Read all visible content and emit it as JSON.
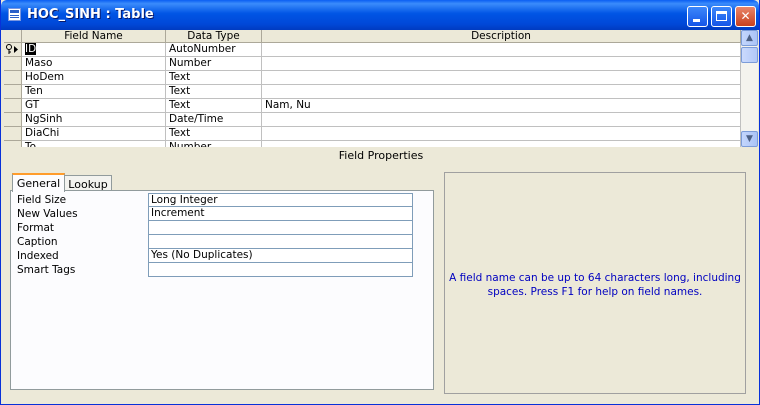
{
  "window": {
    "title": "HOC_SINH : Table"
  },
  "grid": {
    "columns": [
      "Field Name",
      "Data Type",
      "Description"
    ],
    "rows": [
      {
        "name": "ID",
        "type": "AutoNumber",
        "desc": ""
      },
      {
        "name": "Maso",
        "type": "Number",
        "desc": ""
      },
      {
        "name": "HoDem",
        "type": "Text",
        "desc": ""
      },
      {
        "name": "Ten",
        "type": "Text",
        "desc": ""
      },
      {
        "name": "GT",
        "type": "Text",
        "desc": "Nam, Nu"
      },
      {
        "name": "NgSinh",
        "type": "Date/Time",
        "desc": ""
      },
      {
        "name": "DiaChi",
        "type": "Text",
        "desc": ""
      },
      {
        "name": "To",
        "type": "Number",
        "desc": ""
      }
    ]
  },
  "field_properties": {
    "header": "Field Properties",
    "tabs": [
      "General",
      "Lookup"
    ],
    "properties": [
      {
        "label": "Field Size",
        "value": "Long Integer"
      },
      {
        "label": "New Values",
        "value": "Increment"
      },
      {
        "label": "Format",
        "value": ""
      },
      {
        "label": "Caption",
        "value": ""
      },
      {
        "label": "Indexed",
        "value": "Yes (No Duplicates)"
      },
      {
        "label": "Smart Tags",
        "value": ""
      }
    ],
    "help_text": "A field name can be up to 64 characters long, including spaces.  Press F1 for help on field names."
  },
  "icons": {
    "app": "table-icon",
    "primary_key": "key-icon",
    "current_row": "row-pointer-icon"
  },
  "colors": {
    "titlebar": "#0054e3",
    "help_text": "#0000c0",
    "tab_accent": "#ff9c2b"
  }
}
